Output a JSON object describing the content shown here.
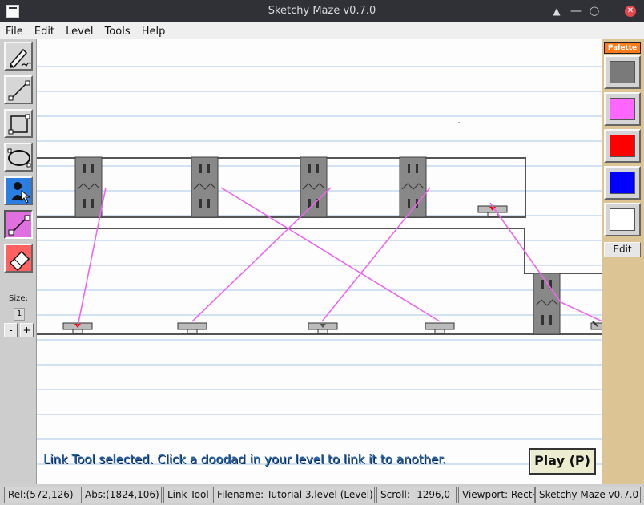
{
  "window": {
    "title": "Sketchy Maze v0.7.0"
  },
  "menu": [
    "File",
    "Edit",
    "Level",
    "Tools",
    "Help"
  ],
  "toolbar": {
    "tools": [
      {
        "name": "pencil-tool",
        "icon": "pencil-icon",
        "active": false
      },
      {
        "name": "line-tool",
        "icon": "line-icon",
        "active": false
      },
      {
        "name": "rectangle-tool",
        "icon": "rectangle-icon",
        "active": false
      },
      {
        "name": "ellipse-tool",
        "icon": "ellipse-icon",
        "active": false
      },
      {
        "name": "actor-tool",
        "icon": "actor-icon",
        "active": false
      },
      {
        "name": "link-tool",
        "icon": "link-icon",
        "active": true
      },
      {
        "name": "eraser-tool",
        "icon": "eraser-icon",
        "active": false
      }
    ],
    "size_label": "Size:",
    "size_value": "1",
    "minus_label": "-",
    "plus_label": "+"
  },
  "canvas": {
    "flash_message": "Link Tool selected. Click a doodad in your level to link it to another.",
    "play_label": "Play (P)"
  },
  "palette": {
    "header": "Palette",
    "colors": [
      "#7a7a7a",
      "#ff66ff",
      "#ff0000",
      "#0000ff",
      "#ffffff"
    ],
    "edit_label": "Edit"
  },
  "status": {
    "rel": "Rel:(572,126)",
    "abs": "Abs:(1824,106)",
    "tool": "Link Tool",
    "filename": "Filename: Tutorial 3.level (Level)",
    "scroll": "Scroll: -1296,0",
    "viewport": "Viewport: Rect<",
    "app": "Sketchy Maze v0.7.0"
  }
}
